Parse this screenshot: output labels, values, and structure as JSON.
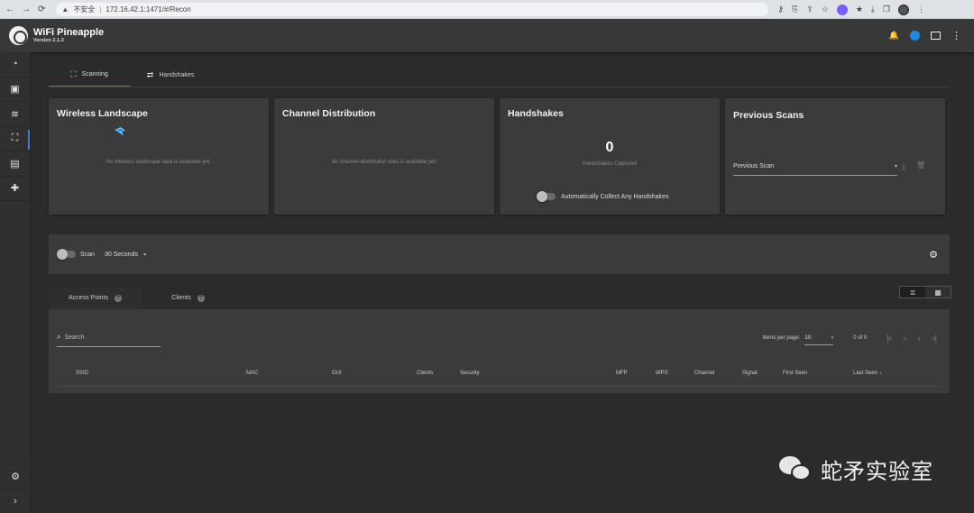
{
  "browser": {
    "nav": [
      "←",
      "→",
      "⟳"
    ],
    "security": "不安全",
    "url": "172.16.42.1:1471/#/Recon",
    "tools": [
      "⚷",
      "⎘",
      "⇪",
      "☆",
      "★",
      "⤓",
      "❐",
      "⋮"
    ]
  },
  "app": {
    "title": "WiFi Pineapple",
    "version": "Version 2.1.3",
    "bell": "🔔",
    "menu": "⋮"
  },
  "sidebar": {
    "items": [
      {
        "icon": "dashboard-icon",
        "glyph": "◔"
      },
      {
        "icon": "briefcase-icon",
        "glyph": "▣"
      },
      {
        "icon": "wifi-icon",
        "glyph": "≋"
      },
      {
        "icon": "binoculars-icon",
        "glyph": "⛶"
      },
      {
        "icon": "document-icon",
        "glyph": "▤"
      },
      {
        "icon": "puzzle-icon",
        "glyph": "✚"
      }
    ],
    "bottom": [
      {
        "icon": "settings-icon",
        "glyph": "⚙"
      },
      {
        "icon": "expand-icon",
        "glyph": "›"
      }
    ]
  },
  "tabs": [
    {
      "label": "Scanning",
      "glyph": "⛶",
      "active": true
    },
    {
      "label": "Handshakes",
      "glyph": "⇄",
      "active": false
    }
  ],
  "cards": {
    "landscape": {
      "title": "Wireless Landscape",
      "empty": "No wireless landscape data is available yet."
    },
    "channels": {
      "title": "Channel Distribution",
      "empty": "No channel distribution data is available yet."
    },
    "handshakes": {
      "title": "Handshakes",
      "count": "0",
      "caption": "Handshakes Captured",
      "toggle_label": "Automatically Collect Any Handshakes"
    },
    "previous": {
      "title": "Previous Scans",
      "select_label": "Previous Scan",
      "caret": "▾",
      "download": "⤓",
      "delete": "🗑"
    }
  },
  "scan": {
    "label": "Scan",
    "duration": "30 Seconds",
    "caret": "▾",
    "gear": "⚙"
  },
  "subtabs": [
    {
      "label": "Access Points",
      "help": "?",
      "active": true
    },
    {
      "label": "Clients",
      "help": "?",
      "active": false
    }
  ],
  "view": {
    "list": "≣",
    "grid": "▦"
  },
  "table": {
    "search_icon": "⌕",
    "search_placeholder": "Search",
    "items_per_page_label": "Items per page:",
    "items_per_page": "10",
    "caret": "▾",
    "range": "0 of 0",
    "pager": [
      "|‹",
      "‹",
      "›",
      "›|"
    ],
    "columns": [
      "SSID",
      "MAC",
      "OUI",
      "Clients",
      "Security",
      "MFP",
      "WPS",
      "Channel",
      "Signal",
      "First Seen",
      "Last Seen ↓"
    ]
  },
  "watermark": "蛇矛实验室"
}
